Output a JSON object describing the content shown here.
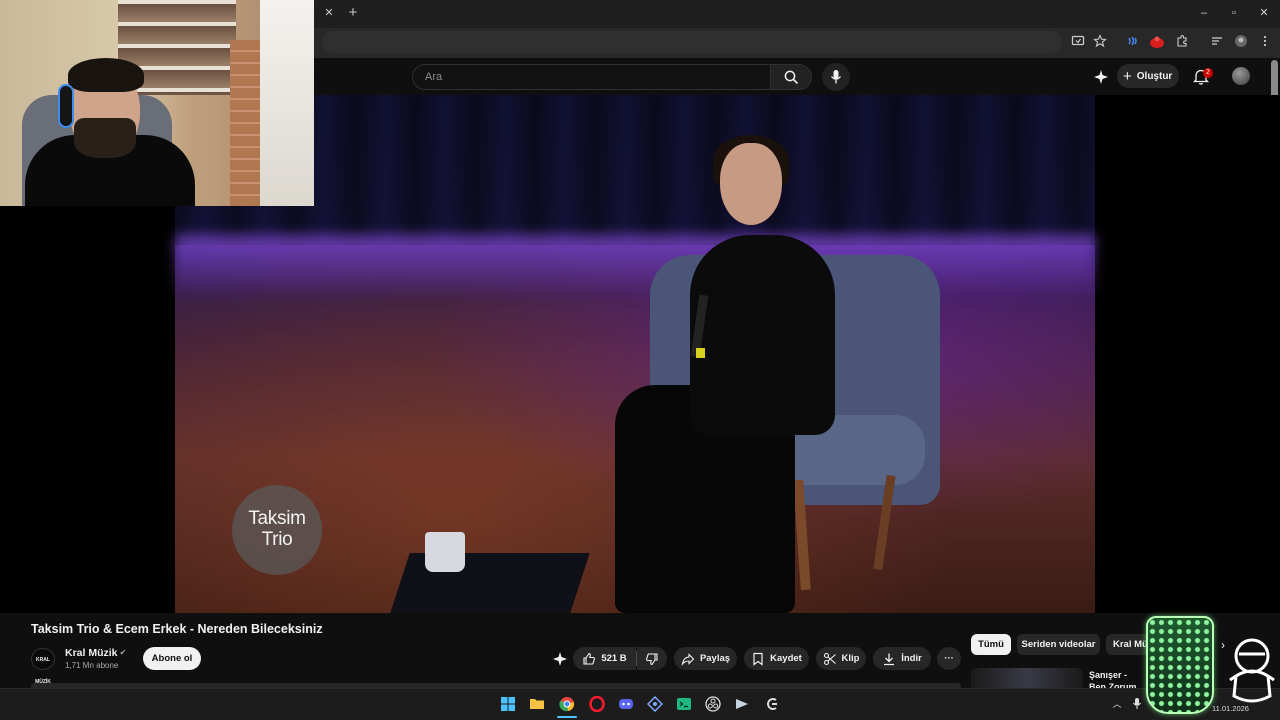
{
  "browser": {
    "tab_close_icon": "✕",
    "new_tab_icon": "+",
    "window_controls": {
      "minimize": "–",
      "maximize": "▫",
      "close": "✕"
    },
    "toolbar_icons": [
      "screen-cast-icon",
      "bookmark-star-icon",
      "extension-wave-icon",
      "extension-red-icon",
      "extensions-puzzle-icon",
      "reading-list-icon",
      "profile-icon",
      "more-menu-icon"
    ]
  },
  "youtube_header": {
    "search_placeholder": "Ara",
    "create_label": "Oluştur",
    "notification_count": "2"
  },
  "player": {
    "watermark_line1": "Taksim",
    "watermark_line2": "Trio"
  },
  "video": {
    "title": "Taksim Trio & Ecem Erkek - Nereden Bileceksiniz",
    "channel_name": "Kral Müzik",
    "channel_logo_text": "KRAL MÜZİK",
    "subscribers": "1,71 Mn abone",
    "subscribe_label": "Abone ol",
    "like_count": "521 B",
    "share_label": "Paylaş",
    "save_label": "Kaydet",
    "clip_label": "Klip",
    "download_label": "İndir",
    "more_label": "···"
  },
  "sidebar": {
    "chips": [
      "Tümü",
      "Seriden videolar",
      "Kral Müzik"
    ],
    "recommendation_title": "Şanışer - Ben Zorum Var (O"
  },
  "taskbar": {
    "apps": [
      "windows-start-icon",
      "file-explorer-icon",
      "chrome-icon",
      "opera-icon",
      "discord-icon",
      "vpn-icon",
      "terminal-icon",
      "obs-icon",
      "steam-icon",
      "app-icon"
    ],
    "date": "11.01.2026"
  },
  "colors": {
    "background": "#0f0f0f",
    "chip_active": "#f1f1f1",
    "button_bg": "#272727",
    "notification_badge": "#cc0000",
    "taskbar_indicator": "#4cc2ff"
  }
}
